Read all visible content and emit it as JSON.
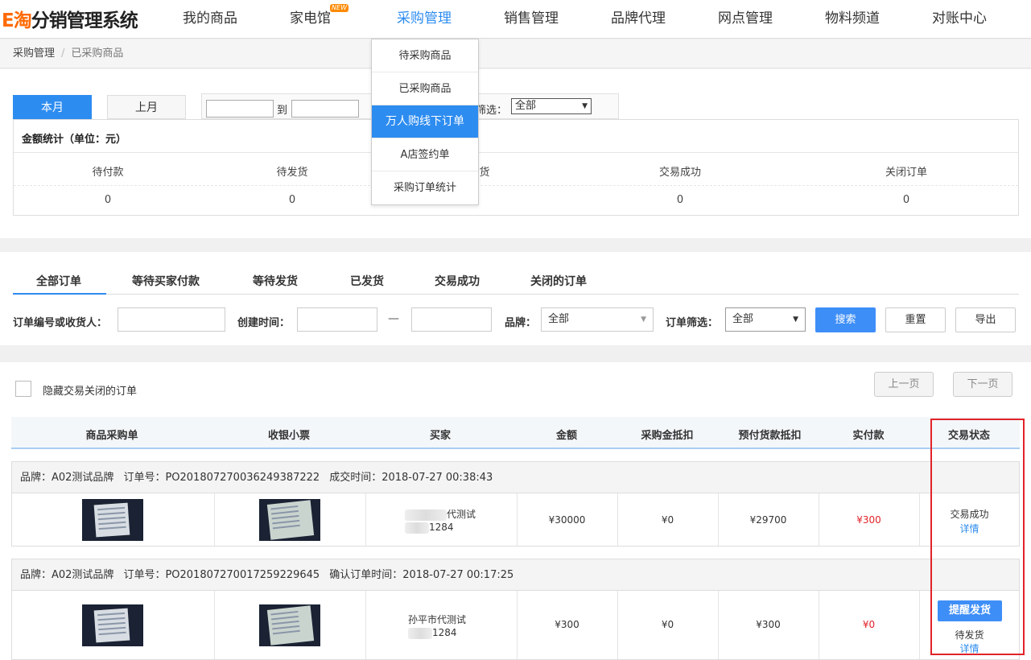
{
  "app": {
    "logo_e": "E淘",
    "logo_rest": "分销管理系统"
  },
  "nav": {
    "items": [
      {
        "label": "我的商品"
      },
      {
        "label": "家电馆",
        "badge": "NEW"
      },
      {
        "label": "采购管理",
        "active": true
      },
      {
        "label": "销售管理"
      },
      {
        "label": "品牌代理"
      },
      {
        "label": "网点管理"
      },
      {
        "label": "物料频道"
      },
      {
        "label": "对账中心"
      }
    ]
  },
  "dropdown": {
    "items": [
      {
        "label": "待采购商品"
      },
      {
        "label": "已采购商品"
      },
      {
        "label": "万人购线下订单",
        "active": true
      },
      {
        "label": "A店签约单"
      },
      {
        "label": "采购订单统计"
      }
    ]
  },
  "breadcrumb": {
    "parent": "采购管理",
    "separator": "/",
    "current": "已采购商品"
  },
  "period": {
    "tabs": [
      {
        "label": "本月",
        "active": true
      },
      {
        "label": "上月"
      }
    ],
    "to_label": "到",
    "filter_label": "筛选：",
    "filter_value": "全部"
  },
  "stats": {
    "title": "金额统计（单位：元）",
    "columns": [
      {
        "label": "待付款",
        "value": "0"
      },
      {
        "label": "待发货",
        "value": "0"
      },
      {
        "label": "货",
        "value": ""
      },
      {
        "label": "交易成功",
        "value": "0"
      },
      {
        "label": "关闭订单",
        "value": "0"
      }
    ]
  },
  "order_tabs": [
    {
      "label": "全部订单",
      "active": true
    },
    {
      "label": "等待买家付款"
    },
    {
      "label": "等待发货"
    },
    {
      "label": "已发货"
    },
    {
      "label": "交易成功"
    },
    {
      "label": "关闭的订单"
    }
  ],
  "filters": {
    "order_no_label": "订单编号或收货人：",
    "order_no_value": "",
    "create_time_label": "创建时间：",
    "dash": "—",
    "brand_label": "品牌：",
    "brand_value": "全部",
    "order_filter_label": "订单筛选：",
    "order_filter_value": "全部",
    "search_label": "搜索",
    "reset_label": "重置",
    "export_label": "导出"
  },
  "list": {
    "hide_closed_label": "隐藏交易关闭的订单",
    "prev_label": "上一页",
    "next_label": "下一页",
    "columns": [
      "商品采购单",
      "收银小票",
      "买家",
      "金额",
      "采购金抵扣",
      "预付货款抵扣",
      "实付款",
      "交易状态"
    ],
    "orders": [
      {
        "brand": "品牌：A02测试品牌",
        "order_no": "订单号：PO201807270036249387222",
        "time": "成交时间：2018-07-27 00:38:43",
        "buyer_line1": "代测试",
        "buyer_line2": "1284",
        "amount": "¥30000",
        "purchase_deduct": "¥0",
        "prepaid_deduct": "¥29700",
        "paid": "¥300",
        "status": "交易成功",
        "detail": "详情"
      },
      {
        "brand": "品牌：A02测试品牌",
        "order_no": "订单号：PO201807270017259229645",
        "time": "确认订单时间：2018-07-27 00:17:25",
        "buyer_line1": "孙平市代测试",
        "buyer_line2": "1284",
        "amount": "¥300",
        "purchase_deduct": "¥0",
        "prepaid_deduct": "¥300",
        "paid": "¥0",
        "remind": "提醒发货",
        "status": "待发货",
        "detail": "详情"
      }
    ]
  },
  "colors": {
    "accent": "#2d8cf0",
    "highlight_frame": "#e2232a",
    "price_red": "#e2232a"
  }
}
